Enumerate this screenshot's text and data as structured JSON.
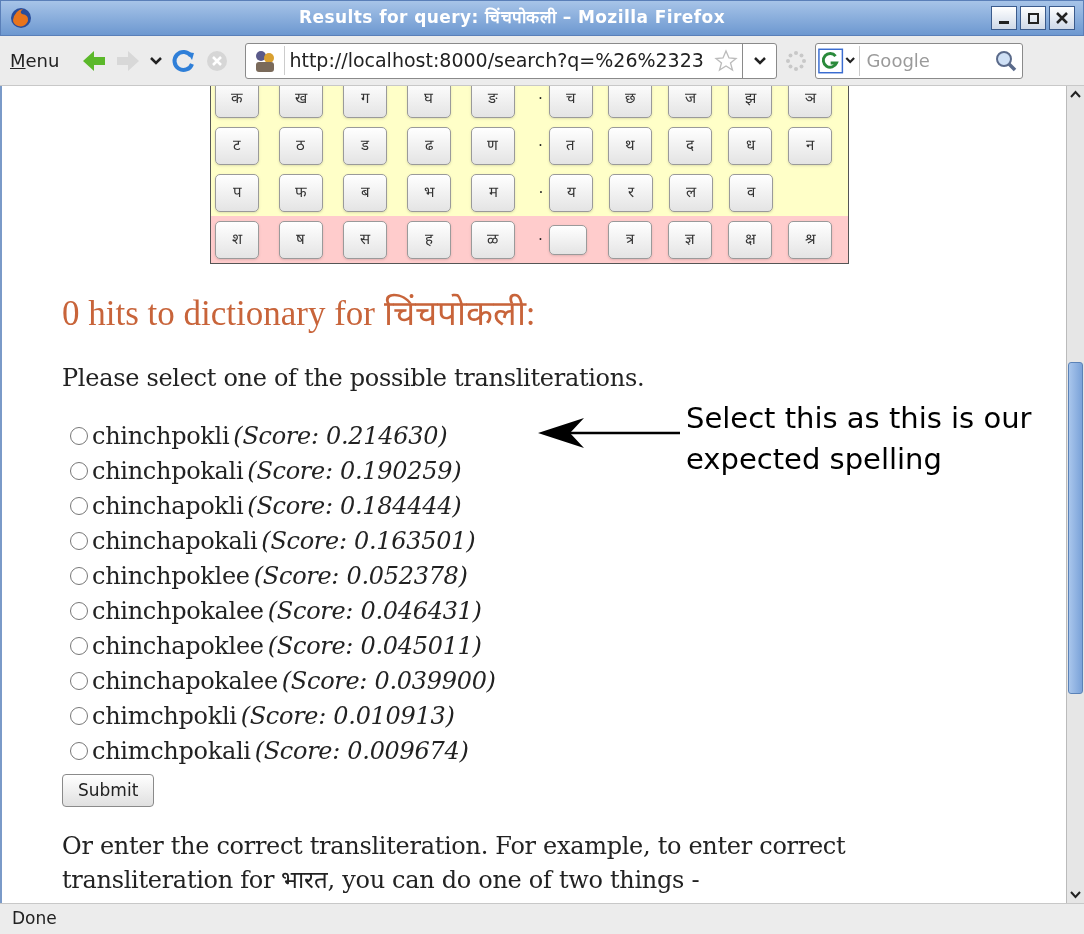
{
  "window": {
    "title": "Results for query: चिंचपोकली – Mozilla Firefox"
  },
  "toolbar": {
    "menu": "Menu",
    "url": "http://localhost:8000/search?q=%26%2323",
    "search": {
      "placeholder": "Google"
    }
  },
  "keyboard": {
    "separator": "·",
    "rows": [
      {
        "color": "#ffffc8",
        "keys": [
          {
            "kind": "char",
            "label": "क"
          },
          {
            "kind": "char",
            "label": "ख"
          },
          {
            "kind": "char",
            "label": "ग"
          },
          {
            "kind": "char",
            "label": "घ"
          },
          {
            "kind": "char",
            "label": "ङ"
          },
          {
            "kind": "char",
            "label": "च"
          },
          {
            "kind": "char",
            "label": "छ"
          },
          {
            "kind": "char",
            "label": "ज"
          },
          {
            "kind": "char",
            "label": "झ"
          },
          {
            "kind": "char",
            "label": "ञ"
          }
        ]
      },
      {
        "color": "#ffffc8",
        "keys": [
          {
            "kind": "char",
            "label": "ट"
          },
          {
            "kind": "char",
            "label": "ठ"
          },
          {
            "kind": "char",
            "label": "ड"
          },
          {
            "kind": "char",
            "label": "ढ"
          },
          {
            "kind": "char",
            "label": "ण"
          },
          {
            "kind": "char",
            "label": "त"
          },
          {
            "kind": "char",
            "label": "थ"
          },
          {
            "kind": "char",
            "label": "द"
          },
          {
            "kind": "char",
            "label": "ध"
          },
          {
            "kind": "char",
            "label": "न"
          }
        ]
      },
      {
        "color": "#ffffc8",
        "keys": [
          {
            "kind": "char",
            "label": "प"
          },
          {
            "kind": "char",
            "label": "फ"
          },
          {
            "kind": "char",
            "label": "ब"
          },
          {
            "kind": "char",
            "label": "भ"
          },
          {
            "kind": "char",
            "label": "म"
          },
          {
            "kind": "char",
            "label": "य"
          },
          {
            "kind": "char",
            "label": "र"
          },
          {
            "kind": "char",
            "label": "ल"
          },
          {
            "kind": "char",
            "label": "व"
          }
        ]
      },
      {
        "color": "#ffcccc",
        "keys": [
          {
            "kind": "char",
            "label": "श"
          },
          {
            "kind": "char",
            "label": "ष"
          },
          {
            "kind": "char",
            "label": "स"
          },
          {
            "kind": "char",
            "label": "ह"
          },
          {
            "kind": "char",
            "label": "ळ"
          },
          {
            "kind": "blank"
          },
          {
            "kind": "char",
            "label": "त्र"
          },
          {
            "kind": "char",
            "label": "ज्ञ"
          },
          {
            "kind": "char",
            "label": "क्ष"
          },
          {
            "kind": "char",
            "label": "श्र"
          }
        ]
      }
    ]
  },
  "heading": "0 hits to dictionary for चिंचपोकली:",
  "prompt": "Please select one of the possible transliterations.",
  "options": [
    {
      "label": "chinchpokli",
      "score": "(Score: 0.214630)",
      "selected": false
    },
    {
      "label": "chinchpokali",
      "score": "(Score: 0.190259)",
      "selected": false
    },
    {
      "label": "chinchapokli",
      "score": "(Score: 0.184444)",
      "selected": false
    },
    {
      "label": "chinchapokali",
      "score": "(Score: 0.163501)",
      "selected": false
    },
    {
      "label": "chinchpoklee",
      "score": "(Score: 0.052378)",
      "selected": false
    },
    {
      "label": "chinchpokalee",
      "score": "(Score: 0.046431)",
      "selected": false
    },
    {
      "label": "chinchapoklee",
      "score": "(Score: 0.045011)",
      "selected": false
    },
    {
      "label": "chinchapokalee",
      "score": "(Score: 0.039900)",
      "selected": false
    },
    {
      "label": "chimchpokli",
      "score": "(Score: 0.010913)",
      "selected": false
    },
    {
      "label": "chimchpokali",
      "score": "(Score: 0.009674)",
      "selected": false
    }
  ],
  "annotation": "Select this as this is our expected spelling",
  "submit": "Submit",
  "footer_text": "Or enter the correct transliteration. For example, to enter correct transliteration for भारत, you can do one of two things -",
  "status_bar": "Done"
}
